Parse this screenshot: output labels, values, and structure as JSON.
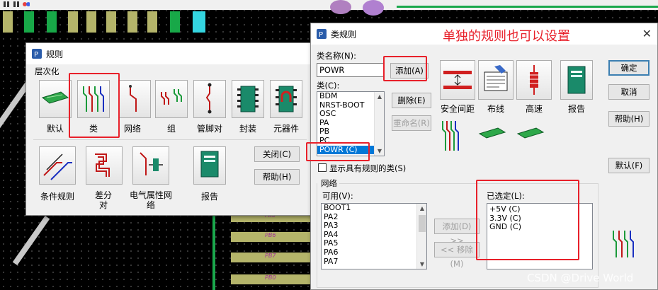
{
  "rules_dialog": {
    "title": "规则",
    "hierarchy_label": "层次化",
    "top_icons": [
      {
        "label": "默认",
        "icon": "pcb-board-icon"
      },
      {
        "label": "类",
        "icon": "class-traces-icon"
      },
      {
        "label": "网络",
        "icon": "net-trace-icon"
      },
      {
        "label": "组",
        "icon": "group-icon"
      },
      {
        "label": "管脚对",
        "icon": "pin-pair-icon"
      },
      {
        "label": "封装",
        "icon": "decal-icon"
      },
      {
        "label": "元器件",
        "icon": "component-icon"
      }
    ],
    "bottom_icons": [
      {
        "label": "条件规则",
        "icon": "conditional-rule-icon"
      },
      {
        "label": "差分对",
        "icon": "diff-pair-icon"
      },
      {
        "label": "电气属性网络",
        "icon": "electrical-net-icon"
      },
      {
        "label": "报告",
        "icon": "report-icon"
      }
    ],
    "close_button": "关闭(C)",
    "help_button": "帮助(H)"
  },
  "class_rules_dialog": {
    "title": "类规则",
    "annotation": "单独的规则也可以设置",
    "class_name_label": "类名称(N):",
    "class_name_value": "POWR",
    "add_button": "添加(A)",
    "class_label": "类(C):",
    "class_list": [
      "BDM",
      "NRST-BOOT",
      "OSC",
      "PA",
      "PB",
      "PC",
      "POWR  (C)"
    ],
    "selected_class": "POWR  (C)",
    "delete_button": "删除(E)",
    "rename_button": "重命名(R)",
    "show_ruled_checkbox": "显示具有规则的类(S)",
    "rule_icons": [
      {
        "label": "安全间距",
        "icon": "clearance-icon"
      },
      {
        "label": "布线",
        "icon": "routing-icon"
      },
      {
        "label": "高速",
        "icon": "high-speed-icon"
      },
      {
        "label": "报告",
        "icon": "report-icon"
      }
    ],
    "ok_button": "确定",
    "cancel_button": "取消",
    "help_button": "帮助(H)",
    "default_button": "默认(F)",
    "net_group_label": "网络",
    "available_label": "可用(V):",
    "available_list": [
      "BOOT1",
      "PA2",
      "PA3",
      "PA4",
      "PA5",
      "PA6",
      "PA7"
    ],
    "add_net_button": "添加(D) >>",
    "remove_net_button": "<< 移除(M)",
    "selected_label": "已选定(L):",
    "selected_list": [
      "+5V  (C)",
      "3.3V  (C)",
      "GND  (C)"
    ]
  },
  "background": {
    "pad_labels": [
      "PA5",
      "PB6",
      "PB7",
      "PB0"
    ]
  },
  "watermark": "CSDN @Drive World",
  "colors": {
    "highlight_red": "#e8202a",
    "selection_blue": "#0078d7",
    "pcb_green": "#1aa84c",
    "pad_yellow": "#b4b46a"
  }
}
